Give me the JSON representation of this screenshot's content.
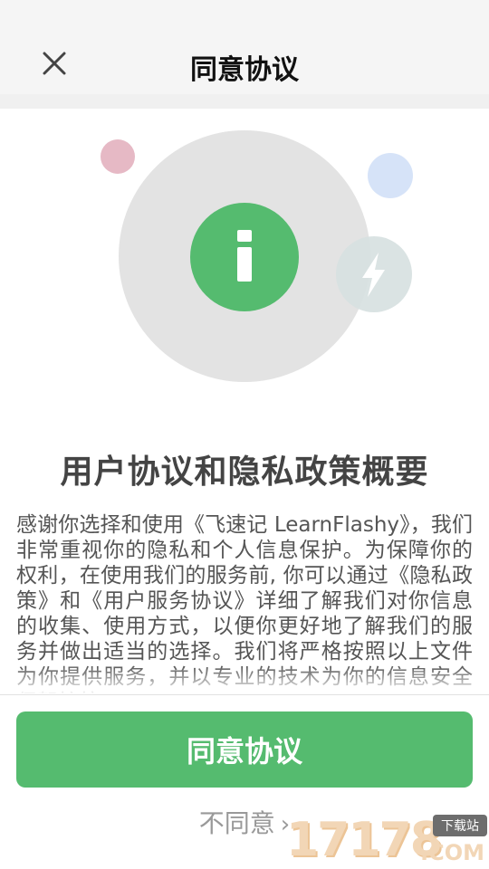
{
  "header": {
    "title": "同意协议",
    "close_icon": "close-icon"
  },
  "illustration": {
    "info_icon": "info-icon",
    "lightning_icon": "lightning-icon",
    "colors": {
      "main_circle": "#e3e3e3",
      "info_circle": "#55bb6f",
      "pink_dot": "#e6b9c5",
      "blue_dot": "#d6e3f8",
      "bolt_circle": "#d6e0e0"
    }
  },
  "main": {
    "heading": "用户协议和隐私政策概要",
    "body": "感谢你选择和使用《飞速记 LearnFlashy》，我们非常重视你的隐私和个人信息保护。为保障你的权利，在使用我们的服务前, 你可以通过《隐私政策》和《用户服务协议》详细了解我们对你信息的收集、使用方式，以便你更好地了解我们的服务并做出适当的选择。我们将严格按照以上文件为你提供服务，并以专业的技术为你的信息安全保驾护航。"
  },
  "actions": {
    "agree_label": "同意协议",
    "disagree_label": "不同意",
    "accent": "#55bb6f"
  },
  "watermark": {
    "digits": "17178",
    "domain": ".COM",
    "tag": "下载站"
  }
}
